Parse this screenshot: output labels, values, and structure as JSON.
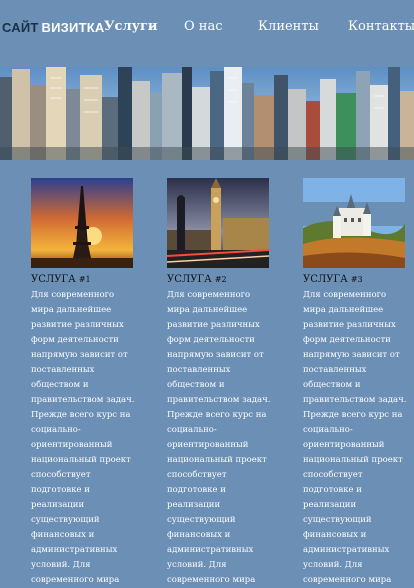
{
  "brand": {
    "part1": "САЙТ",
    "part2": "ВИЗИТКА"
  },
  "nav": [
    {
      "label": "Услуги",
      "active": true
    },
    {
      "label": "О нас",
      "active": false
    },
    {
      "label": "Клиенты",
      "active": false
    },
    {
      "label": "Контакты",
      "active": false
    }
  ],
  "services": [
    {
      "title": "УСЛУГА",
      "number": "#1",
      "image": "eiffel-tower-sunset",
      "text": "Для современного мира дальнейшее развитие различных форм деятельности напрямую зависит от поставленных обществом и правительством задач. Прежде всего курс на социально-ориентированный национальный проект способствует подготовке и реализации существующий финансовых и административных условий. Для современного мира"
    },
    {
      "title": "УСЛУГА",
      "number": "#2",
      "image": "big-ben-night",
      "text": "Для современного мира дальнейшее развитие различных форм деятельности напрямую зависит от поставленных обществом и правительством задач. Прежде всего курс на социально-ориентированный национальный проект способствует подготовке и реализации существующий финансовых и административных условий. Для современного мира"
    },
    {
      "title": "УСЛУГА",
      "number": "#3",
      "image": "neuschwanstein-castle",
      "text": "Для современного мира дальнейшее развитие различных форм деятельности напрямую зависит от поставленных обществом и правительством задач. Прежде всего курс на социально-ориентированный национальный проект способствует подготовке и реализации существующий финансовых и административных условий. Для современного мира"
    }
  ],
  "colors": {
    "background": "#6b8fb5",
    "logo_dark": "#1b3047",
    "text_white": "#ffffff",
    "title_dark": "#111111"
  }
}
